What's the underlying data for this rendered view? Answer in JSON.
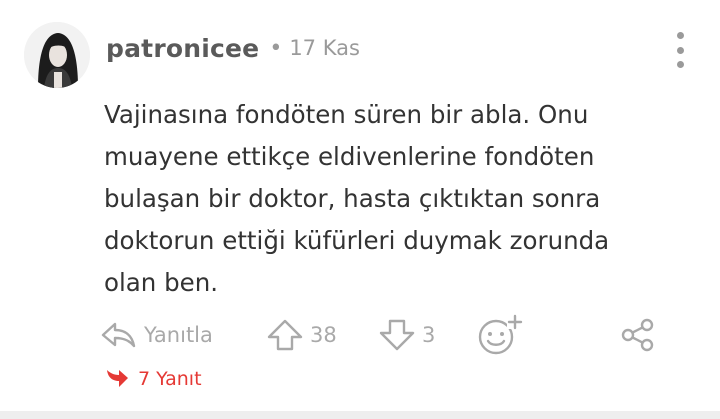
{
  "comment": {
    "author": "patronicee",
    "separator": "•",
    "date": "17 Kas",
    "body": "Vajinasına fondöten süren bir abla. Onu muayene ettikçe eldivenlerine fondöten bulaşan bir doktor, hasta çıktıktan sonra doktorun ettiği küfürleri duymak zorunda olan ben.",
    "actions": {
      "reply_label": "Yanıtla",
      "upvotes": "38",
      "downvotes": "3"
    },
    "replies_label": "7 Yanıt"
  },
  "icons": {
    "avatar": "user-avatar-photo",
    "more": "vertical-dots-icon",
    "reply": "reply-arrow-icon",
    "upvote": "up-arrow-icon",
    "downvote": "down-arrow-icon",
    "emoji": "add-emoji-icon",
    "share": "share-icon",
    "replies": "red-reply-arrow-icon"
  },
  "colors": {
    "text_primary": "#333333",
    "text_muted": "#9a9a9a",
    "icon_muted": "#a9a9a9",
    "accent_red": "#e53935",
    "background": "#ffffff"
  }
}
